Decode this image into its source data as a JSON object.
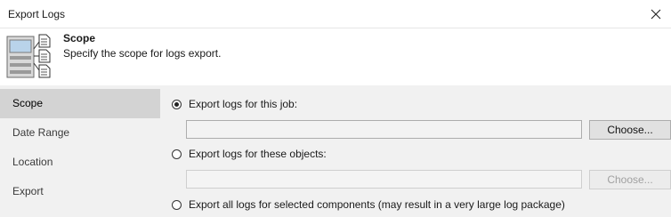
{
  "window": {
    "title": "Export Logs"
  },
  "header": {
    "title": "Scope",
    "subtitle": "Specify the scope for logs export.",
    "icon": "server-logs-icon"
  },
  "sidebar": {
    "items": [
      {
        "label": "Scope",
        "active": true
      },
      {
        "label": "Date Range",
        "active": false
      },
      {
        "label": "Location",
        "active": false
      },
      {
        "label": "Export",
        "active": false
      }
    ]
  },
  "options": {
    "job": {
      "label": "Export logs for this job:",
      "selected": true,
      "value": "",
      "button": "Choose..."
    },
    "objects": {
      "label": "Export logs for these objects:",
      "selected": false,
      "value": "",
      "button": "Choose...",
      "disabled": true
    },
    "all": {
      "label": "Export all logs for selected components (may result in a very large log package)",
      "selected": false
    }
  },
  "colors": {
    "sidebar_bg": "#f1f1f1",
    "active_item_bg": "#d3d3d3"
  }
}
